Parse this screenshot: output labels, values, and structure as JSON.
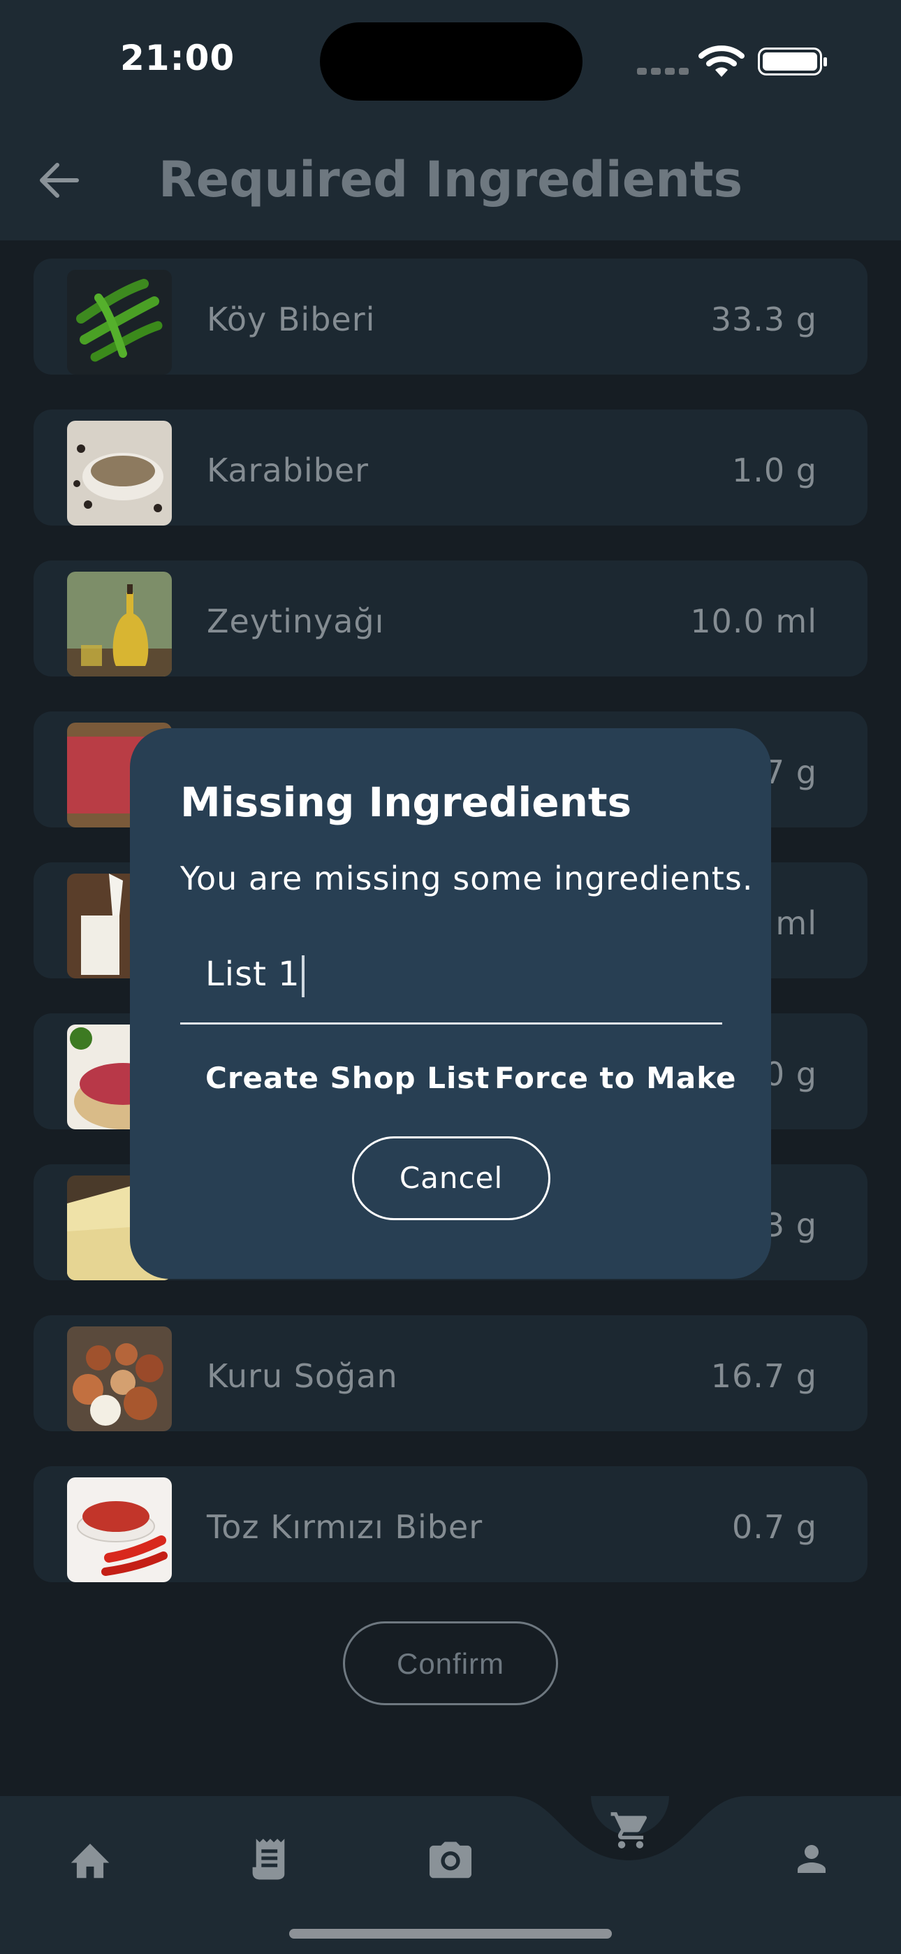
{
  "status": {
    "time": "21:00"
  },
  "header": {
    "title": "Required Ingredients"
  },
  "ingredients": [
    {
      "name": "Köy Biberi",
      "qty": "33.3 g"
    },
    {
      "name": "Karabiber",
      "qty": "1.0 g"
    },
    {
      "name": "Zeytinyağı",
      "qty": "10.0 ml"
    },
    {
      "name": "",
      "qty": "7 g"
    },
    {
      "name": "",
      "qty": "ml"
    },
    {
      "name": "",
      "qty": "0 g"
    },
    {
      "name": "",
      "qty": "3 g"
    },
    {
      "name": "Kuru Soğan",
      "qty": "16.7 g"
    },
    {
      "name": "Toz Kırmızı Biber",
      "qty": "0.7 g"
    }
  ],
  "confirm_label": "Confirm",
  "dialog": {
    "title": "Missing Ingredients",
    "message": "You are missing some ingredients.",
    "input_value": "List 1",
    "create_label": "Create Shop List",
    "force_label": "Force to Make",
    "cancel_label": "Cancel"
  },
  "nav": [
    "home-icon",
    "receipt-icon",
    "camera-icon",
    "cart-icon",
    "person-icon"
  ],
  "colors": {
    "background": "#161d23",
    "card": "#1c2831",
    "dialog": "#283f53",
    "bar": "#1e2a33"
  }
}
